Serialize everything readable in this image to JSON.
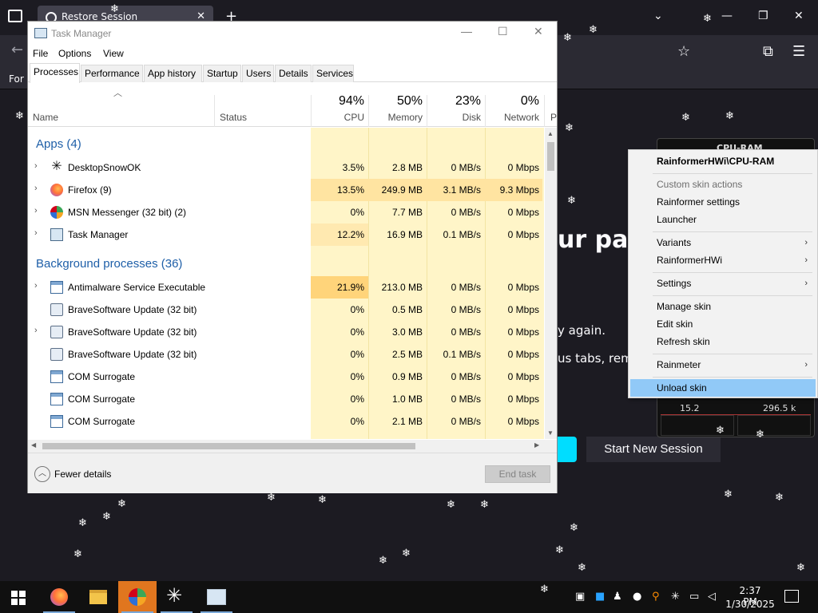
{
  "firefox": {
    "tab_title": "Restore Session",
    "bookmarks_label": "For",
    "heading_fragment": "ur pag",
    "line1_fragment": "y again.",
    "line2_fragment": "us tabs, remov",
    "start_new_session": "Start New Session"
  },
  "rainmeter_skin": {
    "title": "CPU-RAM",
    "left_value": "15.2",
    "right_value": "296.5 k"
  },
  "context_menu": {
    "items": [
      {
        "label": "RainformerHWi\\CPU-RAM",
        "type": "header",
        "submenu": false
      },
      {
        "label": "Custom skin actions",
        "type": "disabled",
        "submenu": false
      },
      {
        "label": "Rainformer settings",
        "type": "normal",
        "submenu": false
      },
      {
        "label": "Launcher",
        "type": "normal",
        "submenu": false
      },
      {
        "label": "Variants",
        "type": "normal",
        "submenu": true
      },
      {
        "label": "RainformerHWi",
        "type": "normal",
        "submenu": true
      },
      {
        "label": "Settings",
        "type": "normal",
        "submenu": true
      },
      {
        "label": "Manage skin",
        "type": "normal",
        "submenu": false
      },
      {
        "label": "Edit skin",
        "type": "normal",
        "submenu": false
      },
      {
        "label": "Refresh skin",
        "type": "normal",
        "submenu": false
      },
      {
        "label": "Rainmeter",
        "type": "normal",
        "submenu": true
      },
      {
        "label": "Unload skin",
        "type": "highlighted",
        "submenu": false
      }
    ]
  },
  "task_manager": {
    "title": "Task Manager",
    "menu": [
      "File",
      "Options",
      "View"
    ],
    "tabs": [
      "Processes",
      "Performance",
      "App history",
      "Startup",
      "Users",
      "Details",
      "Services"
    ],
    "active_tab": "Processes",
    "columns": {
      "name": "Name",
      "status": "Status",
      "cpu": {
        "pct": "94%",
        "label": "CPU"
      },
      "memory": {
        "pct": "50%",
        "label": "Memory"
      },
      "disk": {
        "pct": "23%",
        "label": "Disk"
      },
      "network": {
        "pct": "0%",
        "label": "Network"
      },
      "power_partial": "P"
    },
    "apps_group": "Apps (4)",
    "apps": [
      {
        "name": "DesktopSnowOK",
        "icon": "snowflake-icon",
        "expandable": true,
        "cpu": "3.5%",
        "memory": "2.8 MB",
        "disk": "0 MB/s",
        "network": "0 Mbps"
      },
      {
        "name": "Firefox (9)",
        "icon": "firefox-icon",
        "expandable": true,
        "cpu": "13.5%",
        "memory": "249.9 MB",
        "disk": "3.1 MB/s",
        "network": "9.3 Mbps"
      },
      {
        "name": "MSN Messenger (32 bit) (2)",
        "icon": "msn-icon",
        "expandable": true,
        "cpu": "0%",
        "memory": "7.7 MB",
        "disk": "0 MB/s",
        "network": "0 Mbps"
      },
      {
        "name": "Task Manager",
        "icon": "task-manager-icon",
        "expandable": true,
        "cpu": "12.2%",
        "memory": "16.9 MB",
        "disk": "0.1 MB/s",
        "network": "0 Mbps"
      }
    ],
    "background_group": "Background processes (36)",
    "background": [
      {
        "name": "Antimalware Service Executable",
        "icon": "exe-icon",
        "expandable": true,
        "cpu": "21.9%",
        "memory": "213.0 MB",
        "disk": "0 MB/s",
        "network": "0 Mbps"
      },
      {
        "name": "BraveSoftware Update (32 bit)",
        "icon": "brave-update-icon",
        "expandable": false,
        "cpu": "0%",
        "memory": "0.5 MB",
        "disk": "0 MB/s",
        "network": "0 Mbps"
      },
      {
        "name": "BraveSoftware Update (32 bit)",
        "icon": "brave-update-icon",
        "expandable": true,
        "cpu": "0%",
        "memory": "3.0 MB",
        "disk": "0 MB/s",
        "network": "0 Mbps"
      },
      {
        "name": "BraveSoftware Update (32 bit)",
        "icon": "brave-update-icon",
        "expandable": false,
        "cpu": "0%",
        "memory": "2.5 MB",
        "disk": "0.1 MB/s",
        "network": "0 Mbps"
      },
      {
        "name": "COM Surrogate",
        "icon": "exe-icon",
        "expandable": false,
        "cpu": "0%",
        "memory": "0.9 MB",
        "disk": "0 MB/s",
        "network": "0 Mbps"
      },
      {
        "name": "COM Surrogate",
        "icon": "exe-icon",
        "expandable": false,
        "cpu": "0%",
        "memory": "1.0 MB",
        "disk": "0 MB/s",
        "network": "0 Mbps"
      },
      {
        "name": "COM Surrogate",
        "icon": "exe-icon",
        "expandable": false,
        "cpu": "0%",
        "memory": "2.1 MB",
        "disk": "0 MB/s",
        "network": "0 Mbps"
      }
    ],
    "fewer_details": "Fewer details",
    "end_task": "End task"
  },
  "taskbar": {
    "time": "2:37 PM",
    "date": "1/30/2025",
    "apps": [
      "start-icon",
      "firefox-icon",
      "file-explorer-icon",
      "msn-messenger-icon",
      "snowflake-icon",
      "task-manager-icon"
    ]
  }
}
